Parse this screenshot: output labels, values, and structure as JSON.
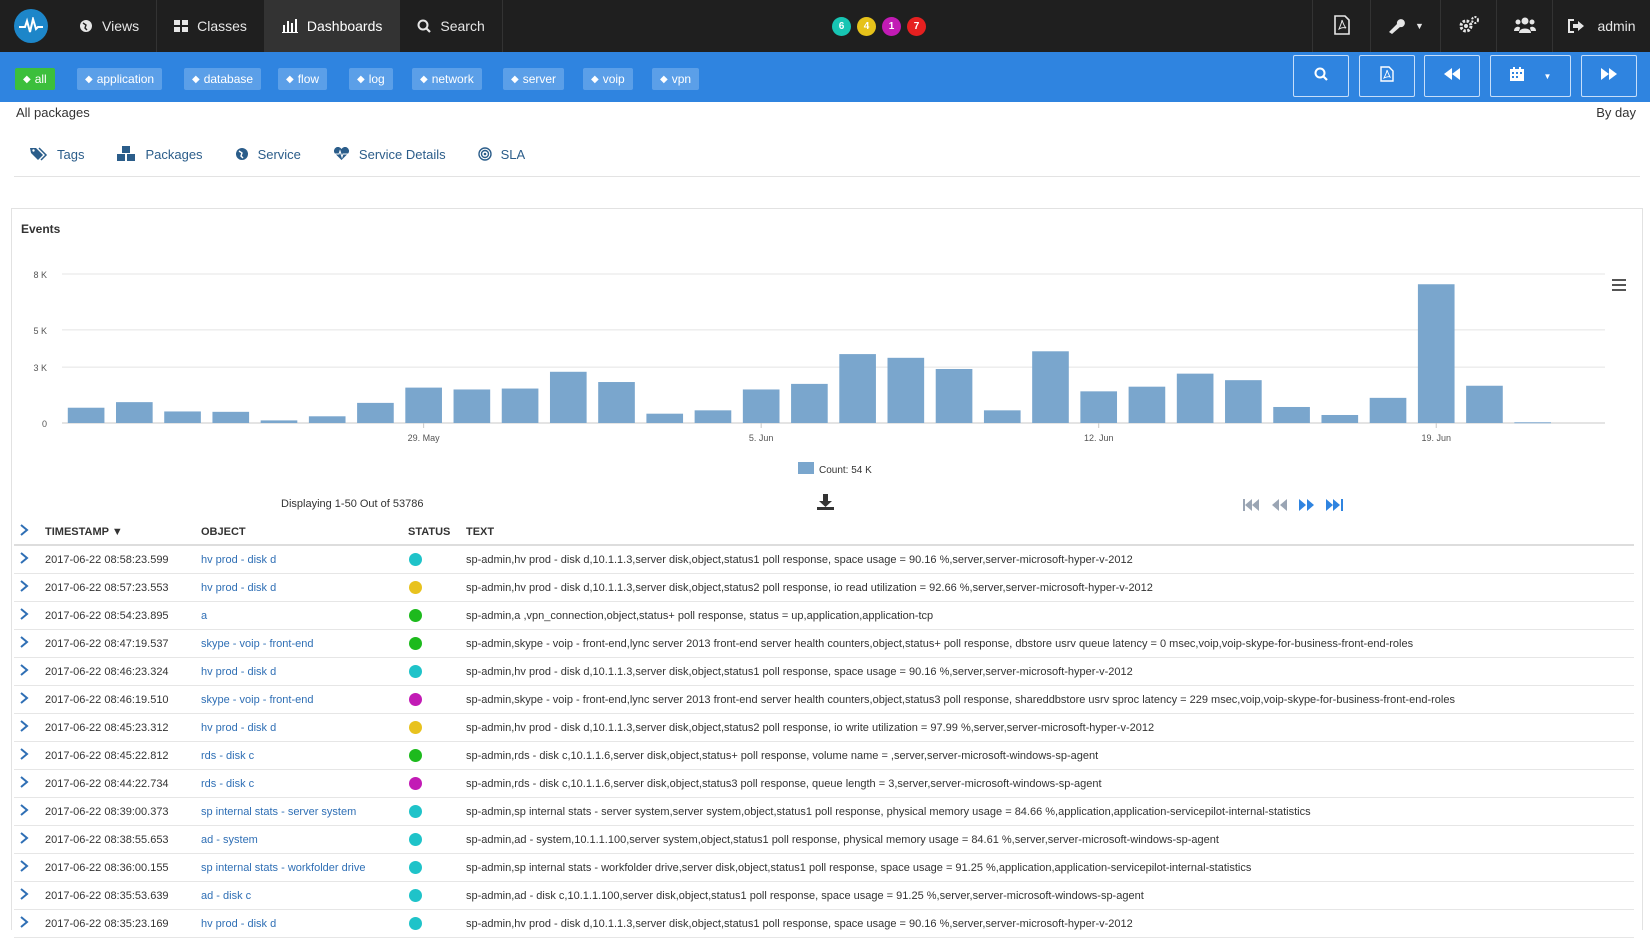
{
  "nav": {
    "items": [
      {
        "label": "Views",
        "icon": "globe-icon"
      },
      {
        "label": "Classes",
        "icon": "grid-icon"
      },
      {
        "label": "Dashboards",
        "icon": "bar-chart-icon"
      },
      {
        "label": "Search",
        "icon": "search-icon"
      }
    ],
    "badges": [
      {
        "value": "6",
        "color": "#17c5b3"
      },
      {
        "value": "4",
        "color": "#e6c21a"
      },
      {
        "value": "1",
        "color": "#c21bb5"
      },
      {
        "value": "7",
        "color": "#e62020"
      }
    ],
    "user": "admin"
  },
  "tags": [
    "all",
    "application",
    "database",
    "flow",
    "log",
    "network",
    "server",
    "voip",
    "vpn"
  ],
  "subheader": {
    "left": "All packages",
    "right": "By day"
  },
  "tabs": [
    "Tags",
    "Packages",
    "Service",
    "Service Details",
    "SLA"
  ],
  "panel": {
    "title": "Events"
  },
  "chart_data": {
    "type": "bar",
    "title": "Events",
    "ylabel": "",
    "xlabel": "",
    "y_ticks": [
      "0",
      "3 K",
      "5 K",
      "8 K"
    ],
    "ylim": [
      0,
      8000
    ],
    "x_ticks": [
      "29. May",
      "5. Jun",
      "12. Jun",
      "19. Jun"
    ],
    "legend": "Count: 54 K",
    "legend_position": "bottom-center",
    "grid": true,
    "color": "#7aa6cd",
    "categories": [
      "2017-05-22",
      "2017-05-23",
      "2017-05-24",
      "2017-05-25",
      "2017-05-26",
      "2017-05-27",
      "2017-05-28",
      "2017-05-29",
      "2017-05-30",
      "2017-05-31",
      "2017-06-01",
      "2017-06-02",
      "2017-06-03",
      "2017-06-04",
      "2017-06-05",
      "2017-06-06",
      "2017-06-07",
      "2017-06-08",
      "2017-06-09",
      "2017-06-10",
      "2017-06-11",
      "2017-06-12",
      "2017-06-13",
      "2017-06-14",
      "2017-06-15",
      "2017-06-16",
      "2017-06-17",
      "2017-06-18",
      "2017-06-19",
      "2017-06-20",
      "2017-06-21",
      "2017-06-22"
    ],
    "values": [
      820,
      1120,
      620,
      600,
      140,
      360,
      1080,
      1900,
      1800,
      1850,
      2750,
      2200,
      500,
      680,
      1800,
      2100,
      3700,
      3500,
      2900,
      680,
      3850,
      1700,
      1950,
      2650,
      2300,
      860,
      430,
      1350,
      7450,
      2000,
      40,
      0
    ]
  },
  "table": {
    "displaying": "Displaying 1-50 Out of 53786",
    "columns": [
      "TIMESTAMP ▼",
      "OBJECT",
      "STATUS",
      "TEXT"
    ],
    "rows": [
      {
        "ts": "2017-06-22 08:58:23.599",
        "obj": "hv prod - disk d",
        "status": "#1fc3c9",
        "text": "sp-admin,hv prod - disk d,10.1.1.3,server disk,object,status1 poll response, space usage = 90.16 %,server,server-microsoft-hyper-v-2012"
      },
      {
        "ts": "2017-06-22 08:57:23.553",
        "obj": "hv prod - disk d",
        "status": "#e8c21e",
        "text": "sp-admin,hv prod - disk d,10.1.1.3,server disk,object,status2 poll response, io read utilization = 92.66 %,server,server-microsoft-hyper-v-2012"
      },
      {
        "ts": "2017-06-22 08:54:23.895",
        "obj": "a",
        "status": "#1dba1d",
        "text": "sp-admin,a        ,vpn_connection,object,status+ poll response, status = up,application,application-tcp"
      },
      {
        "ts": "2017-06-22 08:47:19.537",
        "obj": "skype - voip - front-end",
        "status": "#1dba1d",
        "text": "sp-admin,skype - voip - front-end,lync server 2013 front-end server health counters,object,status+ poll response, dbstore usrv queue latency = 0 msec,voip,voip-skype-for-business-front-end-roles"
      },
      {
        "ts": "2017-06-22 08:46:23.324",
        "obj": "hv prod - disk d",
        "status": "#1fc3c9",
        "text": "sp-admin,hv prod - disk d,10.1.1.3,server disk,object,status1 poll response, space usage = 90.16 %,server,server-microsoft-hyper-v-2012"
      },
      {
        "ts": "2017-06-22 08:46:19.510",
        "obj": "skype - voip - front-end",
        "status": "#c21bb5",
        "text": "sp-admin,skype - voip - front-end,lync server 2013 front-end server health counters,object,status3 poll response, shareddbstore usrv sproc latency = 229 msec,voip,voip-skype-for-business-front-end-roles"
      },
      {
        "ts": "2017-06-22 08:45:23.312",
        "obj": "hv prod - disk d",
        "status": "#e8c21e",
        "text": "sp-admin,hv prod - disk d,10.1.1.3,server disk,object,status2 poll response, io write utilization = 97.99 %,server,server-microsoft-hyper-v-2012"
      },
      {
        "ts": "2017-06-22 08:45:22.812",
        "obj": "rds - disk c",
        "status": "#1dba1d",
        "text": "sp-admin,rds - disk c,10.1.1.6,server disk,object,status+ poll response, volume name = ,server,server-microsoft-windows-sp-agent"
      },
      {
        "ts": "2017-06-22 08:44:22.734",
        "obj": "rds - disk c",
        "status": "#c21bb5",
        "text": "sp-admin,rds - disk c,10.1.1.6,server disk,object,status3 poll response, queue length = 3,server,server-microsoft-windows-sp-agent"
      },
      {
        "ts": "2017-06-22 08:39:00.373",
        "obj": "sp internal stats - server system",
        "status": "#1fc3c9",
        "text": "sp-admin,sp internal stats - server system,server system,object,status1 poll response, physical memory usage = 84.66 %,application,application-servicepilot-internal-statistics"
      },
      {
        "ts": "2017-06-22 08:38:55.653",
        "obj": "ad - system",
        "status": "#1fc3c9",
        "text": "sp-admin,ad - system,10.1.1.100,server system,object,status1 poll response, physical memory usage = 84.61 %,server,server-microsoft-windows-sp-agent"
      },
      {
        "ts": "2017-06-22 08:36:00.155",
        "obj": "sp internal stats - workfolder drive",
        "status": "#1fc3c9",
        "text": "sp-admin,sp internal stats - workfolder drive,server disk,object,status1 poll response, space usage = 91.25 %,application,application-servicepilot-internal-statistics"
      },
      {
        "ts": "2017-06-22 08:35:53.639",
        "obj": "ad - disk c",
        "status": "#1fc3c9",
        "text": "sp-admin,ad - disk c,10.1.1.100,server disk,object,status1 poll response, space usage = 91.25 %,server,server-microsoft-windows-sp-agent"
      },
      {
        "ts": "2017-06-22 08:35:23.169",
        "obj": "hv prod - disk d",
        "status": "#1fc3c9",
        "text": "sp-admin,hv prod - disk d,10.1.1.3,server disk,object,status1 poll response, space usage = 90.16 %,server,server-microsoft-hyper-v-2012"
      }
    ]
  }
}
